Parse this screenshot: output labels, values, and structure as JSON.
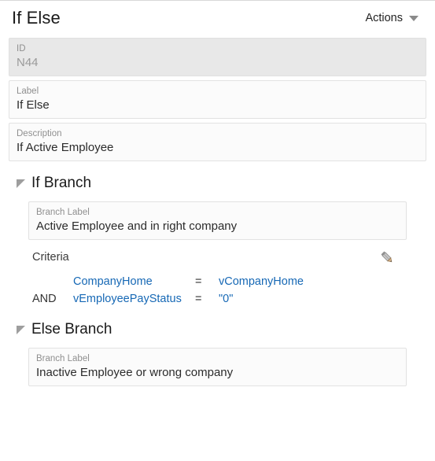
{
  "header": {
    "title": "If Else",
    "actions_label": "Actions",
    "caret_icon": "chevron-down-icon"
  },
  "top_fields": [
    {
      "label": "ID",
      "value": "N44",
      "disabled": true
    },
    {
      "label": "Label",
      "value": "If Else",
      "disabled": false
    },
    {
      "label": "Description",
      "value": "If Active Employee",
      "disabled": false
    }
  ],
  "if_branch": {
    "section_title": "If Branch",
    "disclosure_icon": "triangle-expanded-icon",
    "branch_label_caption": "Branch Label",
    "branch_label_value": "Active Employee and in right company",
    "criteria_title": "Criteria",
    "edit_icon": "pencil-icon",
    "criteria_rows": [
      {
        "conjunction": "",
        "left": "CompanyHome",
        "operator": "=",
        "right": "vCompanyHome"
      },
      {
        "conjunction": "AND",
        "left": "vEmployeePayStatus",
        "operator": "=",
        "right": "\"0\""
      }
    ]
  },
  "else_branch": {
    "section_title": "Else Branch",
    "disclosure_icon": "triangle-expanded-icon",
    "branch_label_caption": "Branch Label",
    "branch_label_value": "Inactive Employee or wrong company"
  },
  "colors": {
    "link_blue": "#1668b5",
    "disabled_bg": "#e8e8e8",
    "field_bg": "#fbfbfb",
    "border": "#e2e2e2"
  }
}
